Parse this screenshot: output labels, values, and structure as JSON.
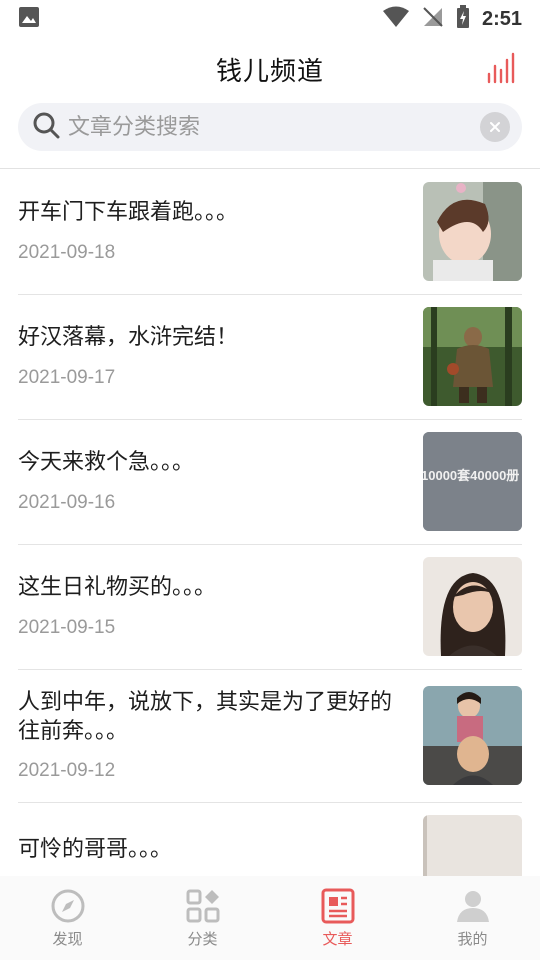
{
  "statusbar": {
    "time": "2:51"
  },
  "header": {
    "title": "钱儿频道"
  },
  "search": {
    "placeholder": "文章分类搜索"
  },
  "articles": [
    {
      "title": "开车门下车跟着跑。。。",
      "date": "2021-09-18",
      "thumb": "child-photo"
    },
    {
      "title": "好汉落幕，水浒完结！",
      "date": "2021-09-17",
      "thumb": "warrior-game-art"
    },
    {
      "title": "今天来救个急。。。",
      "date": "2021-09-16",
      "thumb": "text-image",
      "thumb_text": "10000套40000册"
    },
    {
      "title": "这生日礼物买的。。。",
      "date": "2021-09-15",
      "thumb": "woman-portrait"
    },
    {
      "title": "人到中年，说放下，其实是为了更好的往前奔。。。",
      "date": "2021-09-12",
      "thumb": "father-child-photo"
    },
    {
      "title": "可怜的哥哥。。。",
      "date": "",
      "thumb": "room-photo"
    }
  ],
  "nav": [
    {
      "label": "发现",
      "icon": "compass-icon",
      "active": false
    },
    {
      "label": "分类",
      "icon": "category-grid-icon",
      "active": false
    },
    {
      "label": "文章",
      "icon": "article-icon",
      "active": true
    },
    {
      "label": "我的",
      "icon": "user-icon",
      "active": false
    }
  ],
  "colors": {
    "accent": "#e85a5a",
    "text": "#1e1e1e",
    "muted": "#9a9a9a",
    "search_bg": "#f1f2f6"
  }
}
